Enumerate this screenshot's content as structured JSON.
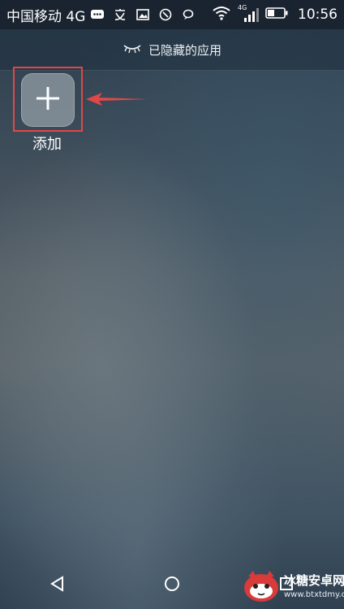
{
  "status_bar": {
    "carrier": "中国移动 4G",
    "signal_tag": "4G",
    "time": "10:56",
    "icons": [
      "message-icon",
      "text-icon",
      "image-icon",
      "shield-icon",
      "chat-bubble-icon",
      "wifi-icon",
      "cell-signal-icon",
      "battery-icon"
    ]
  },
  "header": {
    "icon": "closed-eye-icon",
    "title": "已隐藏的应用"
  },
  "add_app": {
    "label": "添加",
    "icon": "plus-icon"
  },
  "annotation": {
    "highlight_color": "#e04848"
  },
  "nav_bar": {
    "buttons": [
      "back-icon",
      "home-icon",
      "recents-icon"
    ]
  },
  "watermark": {
    "title": "冰糖安卓网",
    "url": "www.btxtdmy.com"
  }
}
